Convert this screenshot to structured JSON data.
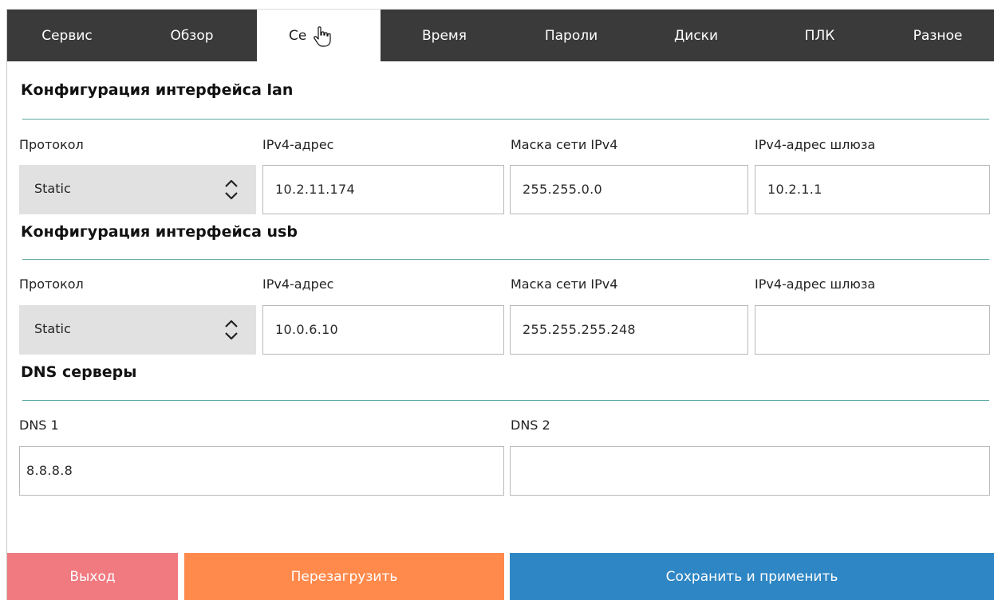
{
  "tabs": [
    {
      "label": "Сервис"
    },
    {
      "label": "Обзор"
    },
    {
      "label": "Се"
    },
    {
      "label": "Время"
    },
    {
      "label": "Пароли"
    },
    {
      "label": "Диски"
    },
    {
      "label": "ПЛК"
    },
    {
      "label": "Разное"
    }
  ],
  "lan": {
    "title": "Конфигурация интерфейса lan",
    "protocol_label": "Протокол",
    "protocol_value": "Static",
    "ip_label": "IPv4-адрес",
    "ip_value": "10.2.11.174",
    "mask_label": "Маска сети IPv4",
    "mask_value": "255.255.0.0",
    "gateway_label": "IPv4-адрес шлюза",
    "gateway_value": "10.2.1.1"
  },
  "usb": {
    "title": "Конфигурация интерфейса usb",
    "protocol_label": "Протокол",
    "protocol_value": "Static",
    "ip_label": "IPv4-адрес",
    "ip_value": "10.0.6.10",
    "mask_label": "Маска сети IPv4",
    "mask_value": "255.255.255.248",
    "gateway_label": "IPv4-адрес шлюза",
    "gateway_value": ""
  },
  "dns": {
    "title": "DNS серверы",
    "dns1_label": "DNS 1",
    "dns1_value": "8.8.8.8",
    "dns2_label": "DNS 2",
    "dns2_value": ""
  },
  "buttons": {
    "exit_label": "Выход",
    "reboot_label": "Перезагрузить",
    "save_label": "Сохранить и применить"
  },
  "colors": {
    "tabbar_bg": "#3a3a3a",
    "divider": "#5aa9a4",
    "exit_button": "#f07a80",
    "reboot_button": "#ff8a4c",
    "save_button": "#2e86c4"
  },
  "icons": {
    "select_arrows": "updown-chevrons-icon",
    "mouse_cursor": "hand-pointer-icon"
  }
}
